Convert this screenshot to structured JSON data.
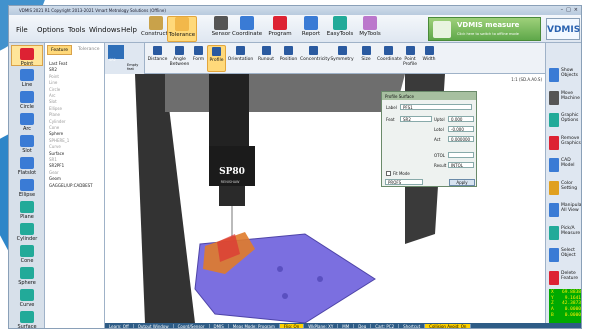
{
  "window": {
    "title": "VDMIS 2021 R1 Copyright 2013-2021 Vmart Metrology Solutions (Offline)"
  },
  "menus": [
    "File",
    "Options",
    "Tools",
    "Windows",
    "Help"
  ],
  "ribbon": [
    {
      "label": "Construction",
      "icon": "construction-icon",
      "color": "#c9a24a"
    },
    {
      "label": "Tolerance",
      "icon": "tolerance-icon",
      "color": "#f2b84a",
      "selected": true
    },
    {
      "label": "Sensor",
      "icon": "sensor-icon",
      "color": "#555"
    },
    {
      "label": "Coordinate",
      "icon": "coordinate-icon",
      "color": "#3a7bd5"
    },
    {
      "label": "Program",
      "icon": "program-icon",
      "color": "#d23"
    },
    {
      "label": "Report",
      "icon": "report-icon",
      "color": "#3a7bd5"
    },
    {
      "label": "EasyTools",
      "icon": "easytools-icon",
      "color": "#2a9"
    },
    {
      "label": "MyTools",
      "icon": "mytools-icon",
      "color": "#b7c"
    }
  ],
  "brand": {
    "title": "VDMIS",
    "title_suffix": " measure",
    "subtitle": "Click here to switch to offline mode",
    "logo": "VDMIS"
  },
  "left_buttons": [
    {
      "label": "Point",
      "icon": "point-icon",
      "selected": true
    },
    {
      "label": "Line",
      "icon": "line-icon"
    },
    {
      "label": "Circle",
      "icon": "circle-icon"
    },
    {
      "label": "Arc",
      "icon": "arc-icon"
    },
    {
      "label": "Slot",
      "icon": "slot-icon"
    },
    {
      "label": "Flatslot",
      "icon": "flatslot-icon"
    },
    {
      "label": "Ellipse",
      "icon": "ellipse-icon"
    },
    {
      "label": "Plane",
      "icon": "plane-icon"
    },
    {
      "label": "Cylinder",
      "icon": "cylinder-icon"
    },
    {
      "label": "Cone",
      "icon": "cone-icon"
    },
    {
      "label": "Sphere",
      "icon": "sphere-icon"
    },
    {
      "label": "Curve",
      "icon": "curve-icon"
    },
    {
      "label": "Surface",
      "icon": "surface-icon"
    }
  ],
  "tree": {
    "tabs": [
      "Feature",
      "Tolerance"
    ],
    "items": [
      {
        "text": "Last Feat",
        "dim": false
      },
      {
        "text": "SR2",
        "dim": false
      },
      {
        "text": "Point",
        "dim": true
      },
      {
        "text": "Line",
        "dim": true
      },
      {
        "text": "Circle",
        "dim": true
      },
      {
        "text": "Arc",
        "dim": true
      },
      {
        "text": "Slot",
        "dim": true
      },
      {
        "text": "Ellipse",
        "dim": true
      },
      {
        "text": "Plane",
        "dim": true
      },
      {
        "text": "Cylinder",
        "dim": true
      },
      {
        "text": "Cone",
        "dim": true
      },
      {
        "text": "Sphere",
        "dim": false
      },
      {
        "text": "SPHERE_1",
        "dim": true
      },
      {
        "text": "Curve",
        "dim": true
      },
      {
        "text": "Surface",
        "dim": false
      },
      {
        "text": "SR1",
        "dim": true
      },
      {
        "text": "SR2PF1",
        "dim": false
      },
      {
        "text": "Gear",
        "dim": true
      },
      {
        "text": "Geom",
        "dim": false
      },
      {
        "text": "GAGGEL/UP:CADBEST",
        "dim": false
      }
    ]
  },
  "thumb": {
    "label": "SR2",
    "sub": "Empty feat"
  },
  "tolerance_tools": [
    {
      "label": "Distance",
      "icon": "distance-icon"
    },
    {
      "label": "Angle Between",
      "icon": "angle-icon"
    },
    {
      "label": "Form",
      "icon": "form-icon"
    },
    {
      "label": "Profile",
      "icon": "profile-icon",
      "selected": true
    },
    {
      "label": "Orientation",
      "icon": "orientation-icon"
    },
    {
      "label": "Runout",
      "icon": "runout-icon"
    },
    {
      "label": "Position",
      "icon": "position-icon"
    },
    {
      "label": "Concentricity",
      "icon": "concentricity-icon"
    },
    {
      "label": "Symmetry",
      "icon": "symmetry-icon"
    },
    {
      "label": "Size",
      "icon": "size-icon"
    },
    {
      "label": "Coordinate",
      "icon": "coord-tool-icon"
    },
    {
      "label": "Point Profile",
      "icon": "point-profile-icon"
    },
    {
      "label": "Width",
      "icon": "width-icon"
    }
  ],
  "right_buttons": [
    {
      "label": "Show Objects",
      "icon": "show-objects-icon"
    },
    {
      "label": "Move Machine",
      "icon": "move-machine-icon"
    },
    {
      "label": "Graphic Options",
      "icon": "graphic-options-icon"
    },
    {
      "label": "Remove Graphics",
      "icon": "remove-graphics-icon"
    },
    {
      "label": "CAD Model",
      "icon": "cad-model-icon"
    },
    {
      "label": "Color Setting",
      "icon": "color-setting-icon"
    },
    {
      "label": "Manipulate All View",
      "icon": "manipulate-icon"
    },
    {
      "label": "Pick/A Measure",
      "icon": "pick-measure-icon"
    },
    {
      "label": "Select Object",
      "icon": "select-object-icon"
    },
    {
      "label": "Delete Feature",
      "icon": "delete-feature-icon"
    },
    {
      "label": "Delete Others",
      "icon": "delete-others-icon"
    }
  ],
  "right_top": "1:1 (SD.A.A0.S)",
  "probe": {
    "label": "SP80",
    "brand": "RENISHAW"
  },
  "dialog": {
    "title": "Profile Surface",
    "label_label": "Label",
    "label_value": "PFS1",
    "feat_label": "Feat",
    "feat_value": "SR2",
    "uptol_label": "Uptol",
    "uptol_value": "0.000",
    "lotol_label": "Lotol",
    "lotol_value": "-0.000",
    "act_label": "Act",
    "act_value": "0.000000",
    "otol_label": "OTOL",
    "result_label": "Result",
    "result_value": "INTOL",
    "fitmode_label": "Fit Mode",
    "select_value": "PROFS",
    "apply_label": "Apply"
  },
  "readout": [
    {
      "axis": "X",
      "value": "69.8838"
    },
    {
      "axis": "Y",
      "value": "9.1641"
    },
    {
      "axis": "Z",
      "value": "42.3873"
    },
    {
      "axis": "A",
      "value": "0.0000"
    },
    {
      "axis": "B",
      "value": "0.0000"
    }
  ],
  "status": [
    {
      "text": "Learn: Off"
    },
    {
      "text": "Output Window"
    },
    {
      "text": "Coord/Sensor"
    },
    {
      "text": "DMIS"
    },
    {
      "text": "Meas Mode: Program"
    },
    {
      "text": "Flip: On",
      "hl": true
    },
    {
      "text": "WkPlane: XY"
    },
    {
      "text": "MM"
    },
    {
      "text": "Deg"
    },
    {
      "text": "Cart: PC2"
    },
    {
      "text": "Shortcut"
    },
    {
      "text": "Collision Avoid: On",
      "hl": true
    }
  ]
}
